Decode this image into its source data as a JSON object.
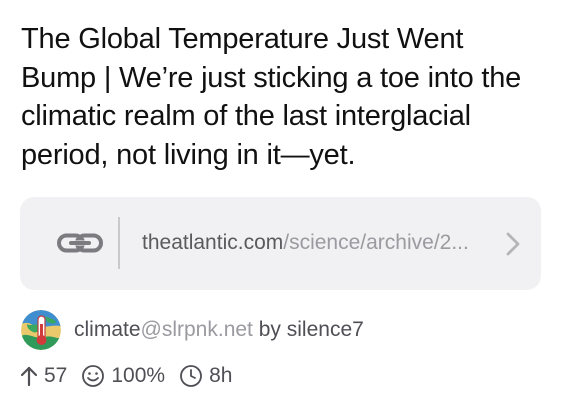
{
  "post": {
    "title": "The Global Temperature Just Went Bump | We’re just sticking a toe into the climatic realm of the last interglacial period, not living in it—yet."
  },
  "link": {
    "domain": "theatlantic.com",
    "path": "/science/archive/2...",
    "icon": "link-icon",
    "chevron_icon": "chevron-right-icon"
  },
  "community": {
    "name": "climate",
    "instance": "@slrpnk.net",
    "by": " by ",
    "user": "silence7"
  },
  "stats": {
    "upvotes": "57",
    "upvote_ratio": "100%",
    "age": "8h"
  },
  "colors": {
    "card_background": "#f1f1f3",
    "secondary_text": "#4f4f55",
    "muted_text": "#9a9aa0"
  }
}
